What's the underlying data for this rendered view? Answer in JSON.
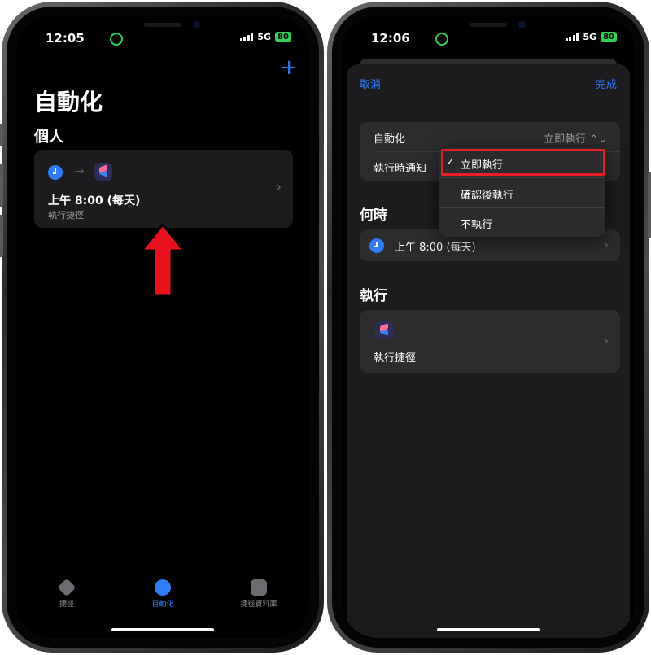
{
  "left_phone": {
    "status": {
      "time": "12:05",
      "network": "5G",
      "battery": "80"
    },
    "add_button": "+",
    "title": "自動化",
    "section_header": "個人",
    "automation_card": {
      "arrow": "→",
      "title": "上午 8:00 (每天)",
      "subtitle": "執行捷徑",
      "chevron": "›"
    },
    "tabs": [
      {
        "label": "捷徑",
        "icon": "layers-icon"
      },
      {
        "label": "自動化",
        "icon": "clock-check-icon",
        "active": true
      },
      {
        "label": "捷徑資料庫",
        "icon": "gallery-icon"
      }
    ]
  },
  "right_phone": {
    "status": {
      "time": "12:06",
      "network": "5G",
      "battery": "80"
    },
    "nav": {
      "cancel": "取消",
      "done": "完成"
    },
    "settings_group": {
      "automation_label": "自動化",
      "automation_value": "立即執行 ⌃⌄",
      "notify_label": "執行時通知"
    },
    "dropdown": {
      "check": "✓",
      "options": [
        "立即執行",
        "確認後執行",
        "不執行"
      ],
      "selected_index": 0
    },
    "when_section": {
      "header": "何時",
      "value": "上午 8:00 (每天)",
      "chevron": "›"
    },
    "do_section": {
      "header": "執行",
      "action_label": "執行捷徑",
      "chevron": "›"
    }
  },
  "colors": {
    "accent": "#2f7cf6",
    "highlight_red": "#e41f24",
    "battery_green": "#31d158",
    "card_bg": "#1c1c1e"
  }
}
